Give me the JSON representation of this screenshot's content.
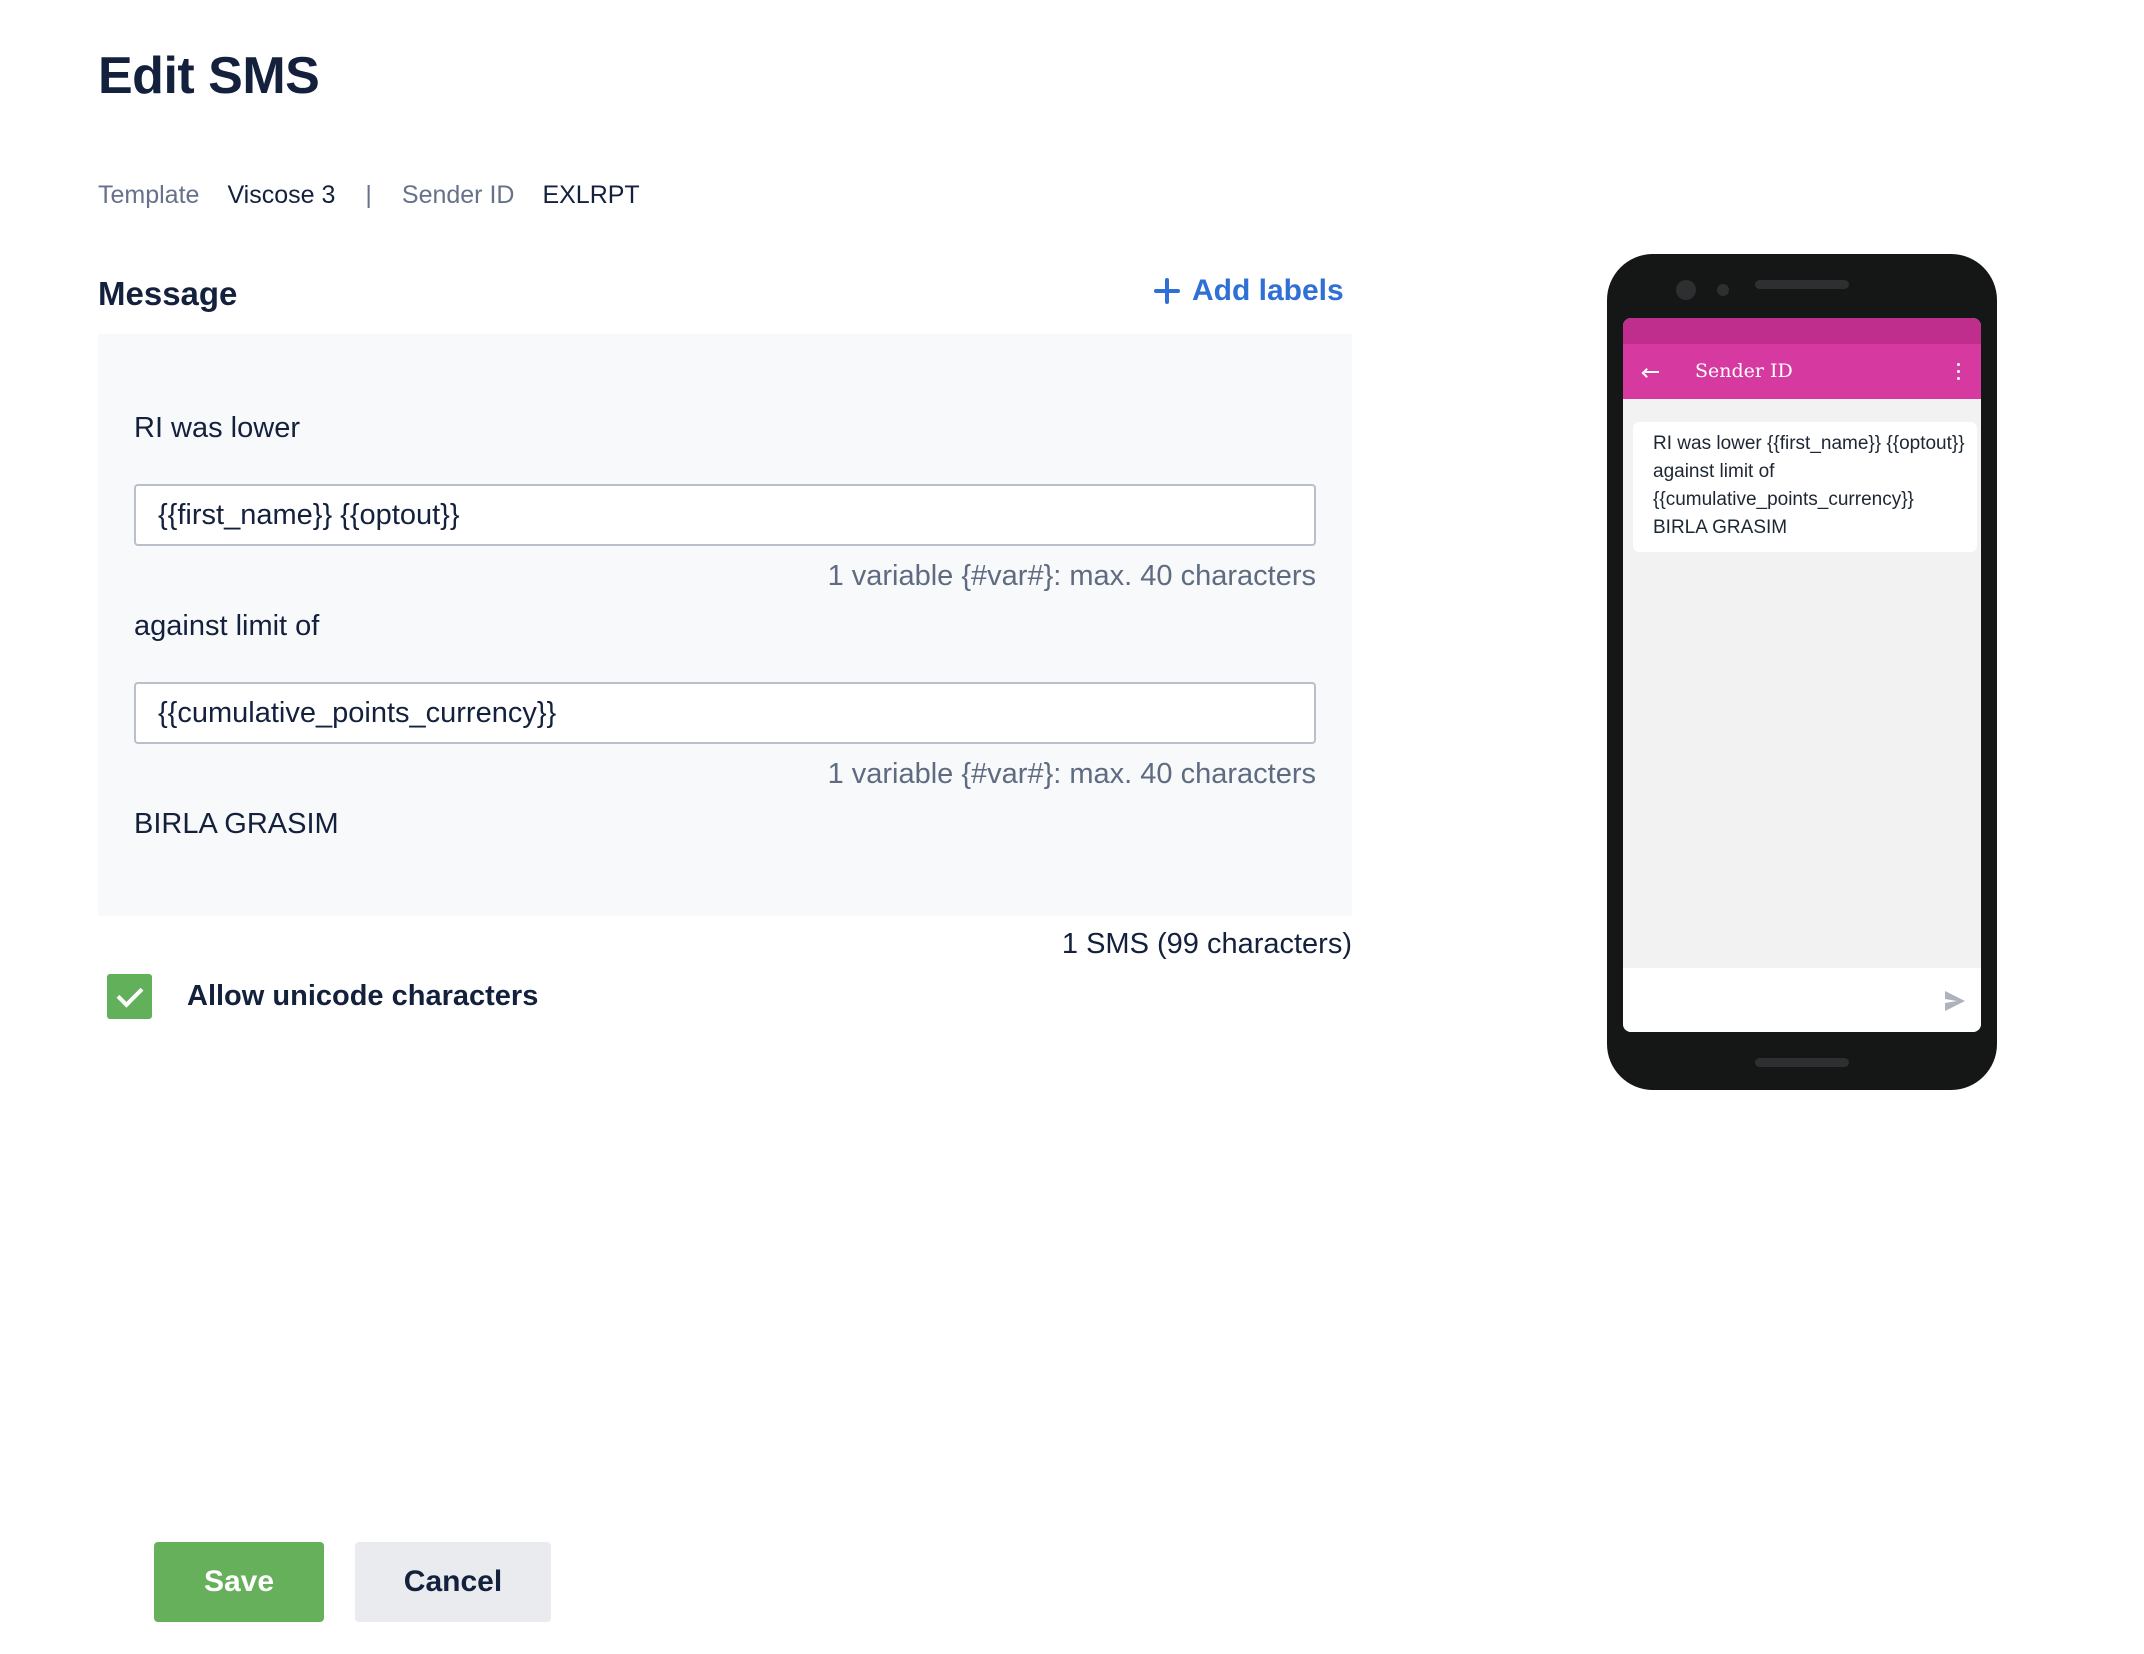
{
  "page": {
    "title": "Edit SMS"
  },
  "meta": {
    "template_label": "Template",
    "template_value": "Viscose 3",
    "separator": "|",
    "sender_label": "Sender ID",
    "sender_value": "EXLRPT"
  },
  "message": {
    "section_title": "Message",
    "add_labels": "Add labels",
    "segments": {
      "text1": "RI was lower",
      "input1_value": "{{first_name}} {{optout}}",
      "hint1": "1 variable {#var#}: max. 40 characters",
      "text2": "against limit of",
      "input2_value": "{{cumulative_points_currency}}",
      "hint2": "1 variable {#var#}: max. 40 characters",
      "text3": "BIRLA GRASIM"
    },
    "sms_count": "1 SMS (99 characters)"
  },
  "unicode": {
    "label": "Allow unicode characters",
    "checked": true
  },
  "actions": {
    "save_label": "Save",
    "cancel_label": "Cancel"
  },
  "preview": {
    "app_bar_title": "Sender ID",
    "message_text": "RI was lower {{first_name}} {{optout}} against limit of {{cumulative_points_currency}} BIRLA GRASIM"
  },
  "colors": {
    "primary_text": "#14213d",
    "link_blue": "#2f6fd6",
    "save_green": "#66b05b",
    "phone_app_bar": "#d63aa0",
    "phone_status_bar": "#bf2e8c"
  }
}
